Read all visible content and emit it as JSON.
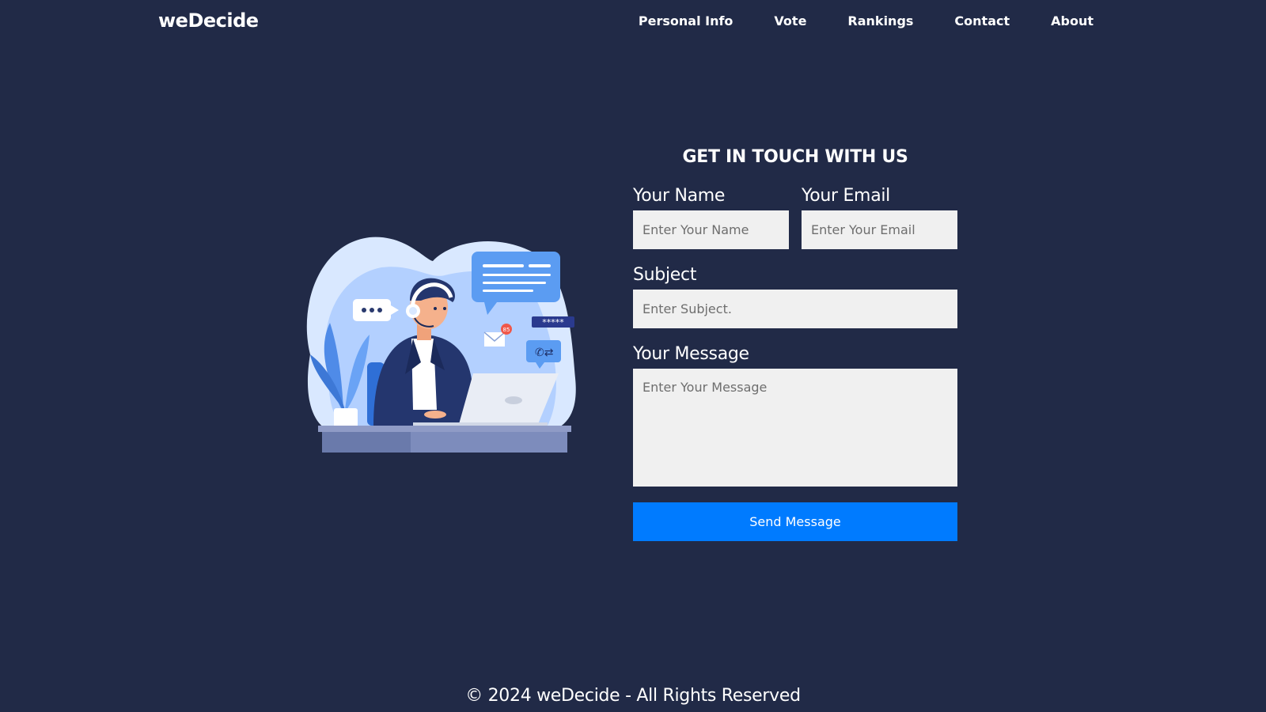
{
  "brand": "weDecide",
  "nav": [
    "Personal Info",
    "Vote",
    "Rankings",
    "Contact",
    "About"
  ],
  "form": {
    "title": "GET IN TOUCH WITH US",
    "name_label": "Your Name",
    "name_placeholder": "Enter Your Name",
    "email_label": "Your Email",
    "email_placeholder": "Enter Your Email",
    "subject_label": "Subject",
    "subject_placeholder": "Enter Subject.",
    "message_label": "Your Message",
    "message_placeholder": "Enter Your Message",
    "submit_label": "Send Message"
  },
  "illustration": {
    "icon": "customer-support-illustration",
    "badge_count": "85",
    "password_mask": "*****"
  },
  "footer": "© 2024 weDecide - All Rights Reserved",
  "colors": {
    "background": "#212a47",
    "button": "#007bff",
    "input_bg": "#f0f0f0"
  }
}
